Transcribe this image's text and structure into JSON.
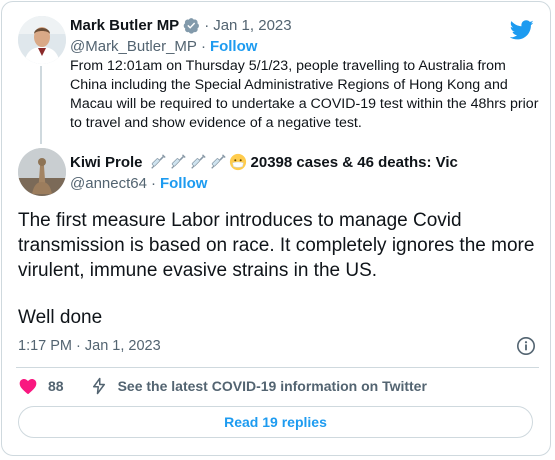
{
  "quoted_tweet": {
    "author_name": "Mark Butler MP",
    "separator": "·",
    "date": "Jan 1, 2023",
    "handle": "@Mark_Butler_MP",
    "follow_label": "Follow",
    "text": "From 12:01am on Thursday 5/1/23, people travelling to Australia from China including the Special Administrative Regions of Hong Kong and Macau will be required to undertake a COVID-19 test within the 48hrs prior to travel and show evidence of a negative test."
  },
  "main_tweet": {
    "author_name": "Kiwi Prole",
    "cases_text": "20398 cases & 46 deaths: Vic",
    "handle": "@annect64",
    "follow_label": "Follow",
    "paragraph_1": "The first measure Labor introduces to manage Covid transmission is based on race. It completely ignores the more virulent, immune evasive strains in the US.",
    "paragraph_2": "Well done",
    "timestamp": "1:17 PM · Jan 1, 2023"
  },
  "actions": {
    "like_count": "88",
    "covid_info_label": "See the latest COVID-19 information on Twitter"
  },
  "replies_button_label": "Read 19 replies",
  "icons": {
    "verified": "verified-badge-icon",
    "twitter": "twitter-bird-icon",
    "syringe": "syringe-icon",
    "mask": "face-with-mask-icon",
    "info": "info-icon",
    "heart": "heart-icon",
    "bolt": "lightning-icon"
  },
  "colors": {
    "accent": "#1d9bf0",
    "heart": "#f91880",
    "text": "#0f1419",
    "muted": "#536471",
    "border": "#cfd9de"
  }
}
